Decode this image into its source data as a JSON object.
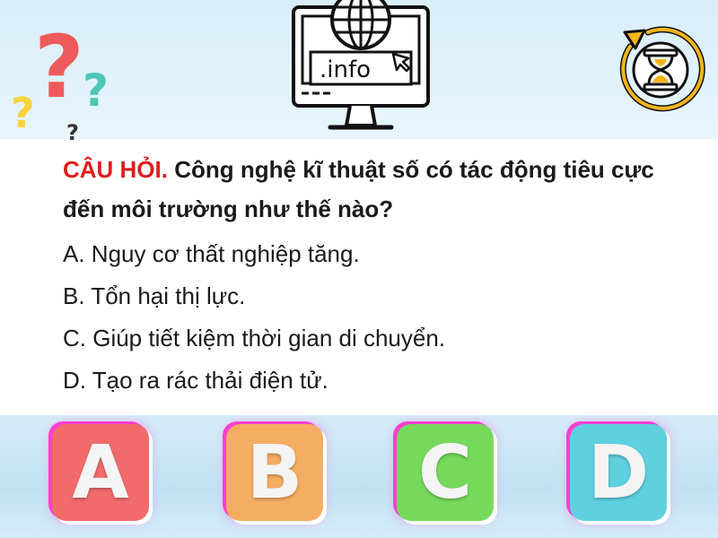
{
  "header": {
    "monitor_text": ".info"
  },
  "question": {
    "label": "CÂU HỎI.",
    "text": "Công nghệ kĩ thuật số có tác động tiêu cực đến môi trường như thế nào?"
  },
  "options": [
    {
      "text": "A. Nguy cơ thất nghiệp tăng."
    },
    {
      "text": "B. Tổn hại thị lực."
    },
    {
      "text": "C. Giúp tiết kiệm thời gian di chuyển."
    },
    {
      "text": "D. Tạo ra rác thải điện tử."
    }
  ],
  "answers": [
    {
      "letter": "A",
      "color": "#f26b6b"
    },
    {
      "letter": "B",
      "color": "#f5ad63"
    },
    {
      "letter": "C",
      "color": "#76d95c"
    },
    {
      "letter": "D",
      "color": "#5fd0df"
    }
  ],
  "icons": [
    "question-marks-icon",
    "monitor-globe-icon",
    "hourglass-timer-icon"
  ]
}
